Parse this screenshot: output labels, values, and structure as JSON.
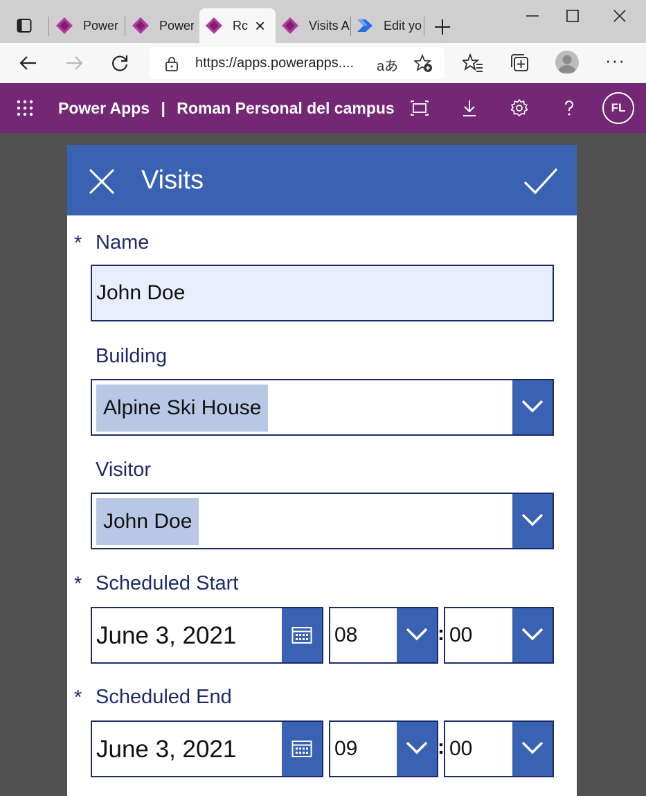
{
  "browser": {
    "tabs": [
      {
        "label": "Power",
        "active": false
      },
      {
        "label": "Power",
        "active": false
      },
      {
        "label": "Rc",
        "active": true
      },
      {
        "label": "Visits A",
        "active": false
      },
      {
        "label": "Edit yo",
        "active": false
      }
    ],
    "url": "https://apps.powerapps....",
    "read_aloud": "aあ"
  },
  "powerapps": {
    "brand": "Power Apps",
    "separator": "|",
    "app_name": "Roman Personal del campus",
    "avatar_initials": "FL"
  },
  "form": {
    "title": "Visits",
    "required_marker": "*",
    "name": {
      "label": "Name",
      "value": "John Doe"
    },
    "building": {
      "label": "Building",
      "value": "Alpine Ski House"
    },
    "visitor": {
      "label": "Visitor",
      "value": "John Doe"
    },
    "scheduled_start": {
      "label": "Scheduled Start",
      "date": "June 3, 2021",
      "hour": "08",
      "minute": "00"
    },
    "scheduled_end": {
      "label": "Scheduled End",
      "date": "June 3, 2021",
      "hour": "09",
      "minute": "00"
    },
    "time_separator": ":"
  },
  "colors": {
    "powerapps_header": "#742774",
    "form_header": "#3a62b3",
    "label_text": "#1f2a6d",
    "input_fill": "#e8eefb",
    "selection_chip": "#b8c8e4"
  },
  "icons": [
    "tab-actions-icon",
    "powerapps-favicon",
    "powerautomate-favicon",
    "new-tab-icon",
    "minimize-icon",
    "maximize-icon",
    "close-window-icon",
    "back-icon",
    "forward-icon",
    "refresh-icon",
    "lock-icon",
    "add-favorite-icon",
    "favorites-icon",
    "collections-icon",
    "profile-icon",
    "more-icon",
    "waffle-icon",
    "fit-screen-icon",
    "download-icon",
    "settings-icon",
    "help-icon",
    "close-icon",
    "checkmark-icon",
    "chevron-down-icon",
    "calendar-icon"
  ]
}
